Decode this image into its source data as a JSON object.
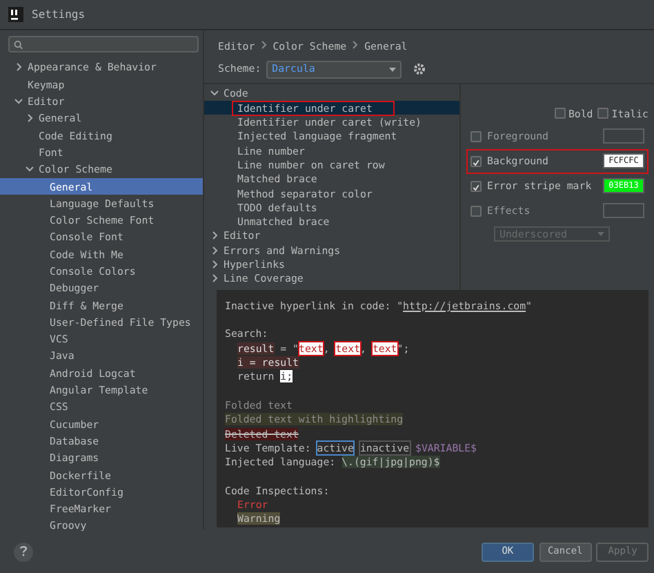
{
  "window": {
    "title": "Settings"
  },
  "sidebar": {
    "items": [
      {
        "label": "Appearance & Behavior",
        "expanded": false,
        "selected": false
      },
      {
        "label": "Keymap",
        "selected": false
      },
      {
        "label": "Editor",
        "expanded": true,
        "selected": false,
        "children": [
          {
            "label": "General",
            "expanded": false,
            "selected": false
          },
          {
            "label": "Code Editing",
            "selected": false
          },
          {
            "label": "Font",
            "selected": false
          },
          {
            "label": "Color Scheme",
            "expanded": true,
            "selected": false,
            "children": [
              {
                "label": "General",
                "selected": true
              },
              {
                "label": "Language Defaults",
                "selected": false
              },
              {
                "label": "Color Scheme Font",
                "selected": false
              },
              {
                "label": "Console Font",
                "selected": false
              },
              {
                "label": "Code With Me",
                "selected": false
              },
              {
                "label": "Console Colors",
                "selected": false
              },
              {
                "label": "Debugger",
                "selected": false
              },
              {
                "label": "Diff & Merge",
                "selected": false
              },
              {
                "label": "User-Defined File Types",
                "selected": false
              },
              {
                "label": "VCS",
                "selected": false
              },
              {
                "label": "Java",
                "selected": false
              },
              {
                "label": "Android Logcat",
                "selected": false
              },
              {
                "label": "Angular Template",
                "selected": false
              },
              {
                "label": "CSS",
                "selected": false
              },
              {
                "label": "Cucumber",
                "selected": false
              },
              {
                "label": "Database",
                "selected": false
              },
              {
                "label": "Diagrams",
                "selected": false
              },
              {
                "label": "Dockerfile",
                "selected": false
              },
              {
                "label": "EditorConfig",
                "selected": false
              },
              {
                "label": "FreeMarker",
                "selected": false
              },
              {
                "label": "Groovy",
                "selected": false
              }
            ]
          }
        ]
      }
    ]
  },
  "breadcrumb": [
    "Editor",
    "Color Scheme",
    "General"
  ],
  "scheme": {
    "label": "Scheme:",
    "value": "Darcula"
  },
  "elements_tree": [
    {
      "label": "Code",
      "expanded": true,
      "children": [
        {
          "label": "Identifier under caret",
          "selected": true,
          "annotated": true
        },
        {
          "label": "Identifier under caret (write)",
          "selected": false,
          "annotated": false
        },
        {
          "label": "Injected language fragment",
          "selected": false,
          "annotated": false
        },
        {
          "label": "Line number",
          "selected": false,
          "annotated": false
        },
        {
          "label": "Line number on caret row",
          "selected": false,
          "annotated": false
        },
        {
          "label": "Matched brace",
          "selected": false,
          "annotated": false
        },
        {
          "label": "Method separator color",
          "selected": false,
          "annotated": false
        },
        {
          "label": "TODO defaults",
          "selected": false,
          "annotated": false
        },
        {
          "label": "Unmatched brace",
          "selected": false,
          "annotated": false
        }
      ]
    },
    {
      "label": "Editor",
      "expanded": false
    },
    {
      "label": "Errors and Warnings",
      "expanded": false
    },
    {
      "label": "Hyperlinks",
      "expanded": false
    },
    {
      "label": "Line Coverage",
      "expanded": false
    }
  ],
  "font_styles": [
    {
      "label": "Bold",
      "checked": false
    },
    {
      "label": "Italic",
      "checked": false
    }
  ],
  "attributes": [
    {
      "label": "Foreground",
      "checked": false,
      "annotated": false
    },
    {
      "label": "Background",
      "checked": true,
      "annotated": true,
      "value": "FCFCFC",
      "color": "#fcfcfc"
    },
    {
      "label": "Error stripe mark",
      "checked": true,
      "annotated": false,
      "value": "03EB13",
      "color": "#03eb13"
    },
    {
      "label": "Effects",
      "checked": false,
      "annotated": false
    }
  ],
  "effect_type": {
    "value": "Underscored",
    "disabled": true
  },
  "preview_lines": [
    {
      "indented": false,
      "gap_before": false,
      "segments": [
        {
          "text": "Inactive hyperlink in code: \"",
          "kind": "plain"
        },
        {
          "text": "http://jetbrains.com",
          "kind": "link"
        },
        {
          "text": "\"",
          "kind": "plain"
        }
      ]
    },
    {
      "indented": false,
      "gap_before": true,
      "segments": [
        {
          "text": "Search:",
          "kind": "plain"
        }
      ]
    },
    {
      "indented": true,
      "gap_before": false,
      "segments": [
        {
          "text": "result",
          "kind": "write"
        },
        {
          "text": " = \"",
          "kind": "plain"
        },
        {
          "text": "text",
          "kind": "hit"
        },
        {
          "text": ", ",
          "kind": "plain"
        },
        {
          "text": "text",
          "kind": "hit"
        },
        {
          "text": ", ",
          "kind": "plain"
        },
        {
          "text": "text",
          "kind": "hit"
        },
        {
          "text": "\";",
          "kind": "plain"
        }
      ]
    },
    {
      "indented": true,
      "gap_before": false,
      "segments": [
        {
          "text": "i = result",
          "kind": "write"
        }
      ]
    },
    {
      "indented": true,
      "gap_before": false,
      "segments": [
        {
          "text": "return ",
          "kind": "plain"
        },
        {
          "text": "i;",
          "kind": "caret"
        }
      ]
    },
    {
      "indented": false,
      "gap_before": true,
      "segments": [
        {
          "text": "Folded text",
          "kind": "folded"
        }
      ]
    },
    {
      "indented": false,
      "gap_before": false,
      "segments": [
        {
          "text": "Folded text with highlighting",
          "kind": "folded-hl"
        }
      ]
    },
    {
      "indented": false,
      "gap_before": false,
      "segments": [
        {
          "text": "Deleted text",
          "kind": "deleted"
        }
      ]
    },
    {
      "indented": false,
      "gap_before": false,
      "segments": [
        {
          "text": "Live Template: ",
          "kind": "plain"
        },
        {
          "text": "active",
          "kind": "tpl-active"
        },
        {
          "text": "inactive",
          "kind": "tpl-inactive"
        },
        {
          "text": " $VARIABLE$",
          "kind": "variable"
        }
      ]
    },
    {
      "indented": false,
      "gap_before": false,
      "segments": [
        {
          "text": "Injected language: ",
          "kind": "plain"
        },
        {
          "text": "\\.(gif|jpg|png)$",
          "kind": "injected"
        }
      ]
    },
    {
      "indented": false,
      "gap_before": true,
      "segments": [
        {
          "text": "Code Inspections:",
          "kind": "plain"
        }
      ]
    },
    {
      "indented": true,
      "gap_before": false,
      "segments": [
        {
          "text": "Error",
          "kind": "error"
        }
      ]
    },
    {
      "indented": true,
      "gap_before": false,
      "segments": [
        {
          "text": "Warning",
          "kind": "warning"
        }
      ]
    }
  ],
  "buttons": [
    {
      "label": "OK",
      "kind": "primary"
    },
    {
      "label": "Cancel",
      "kind": "normal"
    },
    {
      "label": "Apply",
      "kind": "disabled"
    }
  ]
}
